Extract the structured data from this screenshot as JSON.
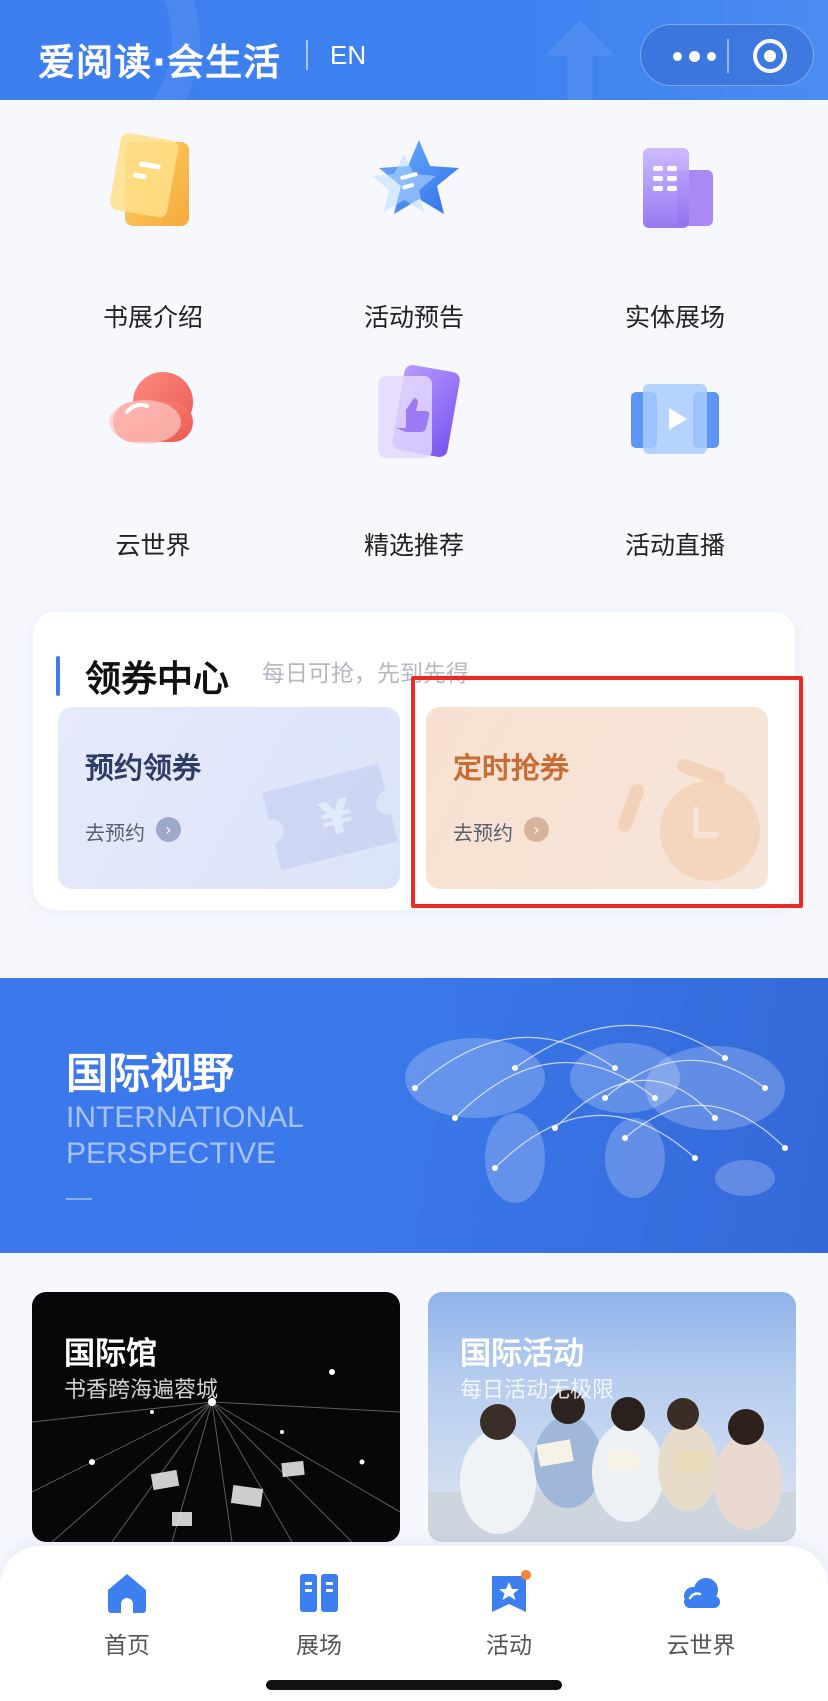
{
  "header": {
    "brand": "爱阅读·会生活",
    "lang_label": "EN",
    "more_icon": "more-dots-icon",
    "close_icon": "target-circle-icon"
  },
  "grid": {
    "items": [
      {
        "label": "书展介绍",
        "icon": "document-icon"
      },
      {
        "label": "活动预告",
        "icon": "star-icon"
      },
      {
        "label": "实体展场",
        "icon": "building-icon"
      },
      {
        "label": "云世界",
        "icon": "cloud-icon"
      },
      {
        "label": "精选推荐",
        "icon": "thumbs-up-icon"
      },
      {
        "label": "活动直播",
        "icon": "play-icon"
      }
    ]
  },
  "coupon": {
    "title": "领券中心",
    "subtitle": "每日可抢，先到先得",
    "cards": [
      {
        "title": "预约领券",
        "link": "去预约"
      },
      {
        "title": "定时抢券",
        "link": "去预约"
      }
    ]
  },
  "intl": {
    "title": "国际视野",
    "en_line1": "INTERNATIONAL",
    "en_line2": "PERSPECTIVE"
  },
  "features": [
    {
      "title": "国际馆",
      "subtitle": "书香跨海遍蓉城"
    },
    {
      "title": "国际活动",
      "subtitle": "每日活动无极限"
    }
  ],
  "tabbar": {
    "tabs": [
      {
        "label": "首页",
        "icon": "home-icon"
      },
      {
        "label": "展场",
        "icon": "book-icon"
      },
      {
        "label": "活动",
        "icon": "star-badge-icon"
      },
      {
        "label": "云世界",
        "icon": "cloud-icon"
      }
    ]
  },
  "colors": {
    "primary": "#3d7ff0",
    "coupon_orange": "#c76c34",
    "highlight_red": "#ea2a23"
  }
}
